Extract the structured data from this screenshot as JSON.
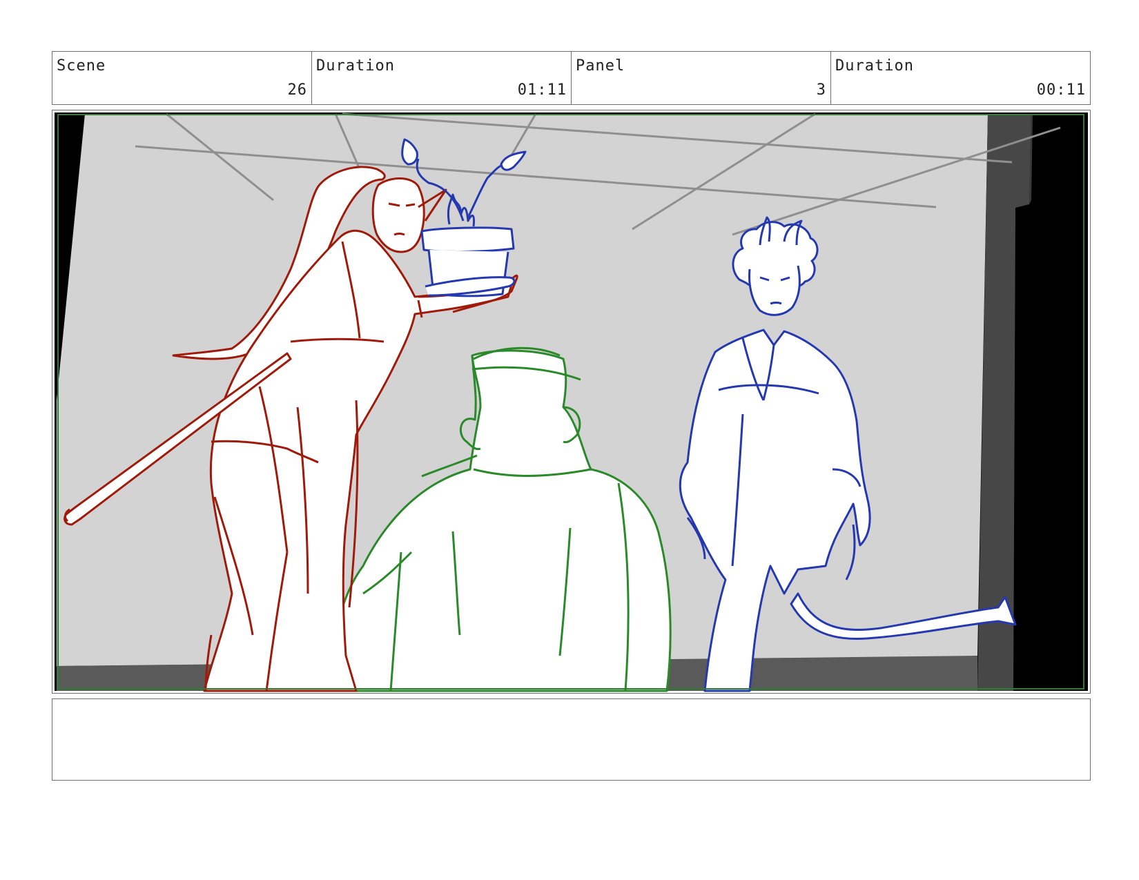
{
  "header": {
    "scene_label": "Scene",
    "scene_value": "26",
    "duration_label": "Duration",
    "duration_value": "01:11",
    "panel_label": "Panel",
    "panel_value": "3",
    "panel_duration_label": "Duration",
    "panel_duration_value": "00:11"
  },
  "drawing": {
    "colors": {
      "background_wall": "#d3d3d3",
      "floor_shadow": "#5a5a5a",
      "right_wall": "#474747",
      "letterbox": "#000000",
      "ceiling_lines": "#8f8f8f",
      "safe_frame": "#2e7d32",
      "red_character": "#a01a0a",
      "green_character": "#2a8a2a",
      "blue_character": "#2438b0"
    }
  },
  "notes": {
    "text": ""
  }
}
